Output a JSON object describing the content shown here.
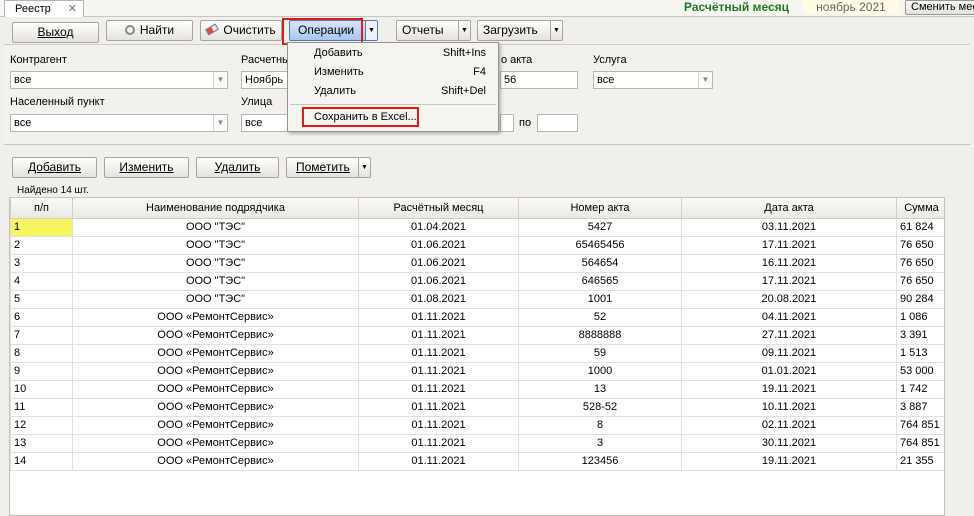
{
  "tab": {
    "label": "Реестр",
    "close": "✕"
  },
  "header": {
    "month_label": "Расчётный месяц",
    "month_value": "ноябрь 2021",
    "change_button": "Сменить мес"
  },
  "toolbar": {
    "exit": "Выход",
    "find": "Найти",
    "clear": "Очистить",
    "operations": "Операции",
    "reports": "Отчеты",
    "load": "Загрузить"
  },
  "filters": {
    "contractor": {
      "label": "Контрагент",
      "value": "все"
    },
    "settlement": {
      "label": "Населенный пункт",
      "value": "все"
    },
    "calc_month": {
      "label": "Расчетны",
      "value": "Ноябрь"
    },
    "street": {
      "label": "Улица",
      "value": "все"
    },
    "act_no": {
      "label": "о акта",
      "value": "56"
    },
    "service": {
      "label": "Услуга",
      "value": "все"
    },
    "range_to_label": "по"
  },
  "menu": {
    "items": [
      {
        "label": "Добавить",
        "shortcut": "Shift+Ins"
      },
      {
        "label": "Изменить",
        "shortcut": "F4"
      },
      {
        "label": "Удалить",
        "shortcut": "Shift+Del"
      },
      {
        "label": "Сохранить в Excel...",
        "shortcut": ""
      }
    ]
  },
  "actions": {
    "add": "Добавить",
    "edit": "Изменить",
    "delete": "Удалить",
    "mark": "Пометить"
  },
  "found_text": "Найдено 14 шт.",
  "table": {
    "columns": [
      "п/п",
      "Наименование подрядчика",
      "Расчётный месяц",
      "Номер акта",
      "Дата акта",
      "Сумма"
    ],
    "rows": [
      [
        "1",
        "ООО \"ТЭС\"",
        "01.04.2021",
        "5427",
        "03.11.2021",
        "61 824"
      ],
      [
        "2",
        "ООО \"ТЭС\"",
        "01.06.2021",
        "65465456",
        "17.11.2021",
        "76 650"
      ],
      [
        "3",
        "ООО \"ТЭС\"",
        "01.06.2021",
        "564654",
        "16.11.2021",
        "76 650"
      ],
      [
        "4",
        "ООО \"ТЭС\"",
        "01.06.2021",
        "646565",
        "17.11.2021",
        "76 650"
      ],
      [
        "5",
        "ООО \"ТЭС\"",
        "01.08.2021",
        "1001",
        "20.08.2021",
        "90 284"
      ],
      [
        "6",
        "ООО  «РемонтСервис»",
        "01.11.2021",
        "52",
        "04.11.2021",
        "1 086"
      ],
      [
        "7",
        "ООО  «РемонтСервис»",
        "01.11.2021",
        "8888888",
        "27.11.2021",
        "3 391"
      ],
      [
        "8",
        "ООО  «РемонтСервис»",
        "01.11.2021",
        "59",
        "09.11.2021",
        "1 513"
      ],
      [
        "9",
        "ООО  «РемонтСервис»",
        "01.11.2021",
        "1000",
        "01.01.2021",
        "53 000"
      ],
      [
        "10",
        "ООО  «РемонтСервис»",
        "01.11.2021",
        "13",
        "19.11.2021",
        "1 742"
      ],
      [
        "11",
        "ООО  «РемонтСервис»",
        "01.11.2021",
        "528-52",
        "10.11.2021",
        "3 887"
      ],
      [
        "12",
        "ООО  «РемонтСервис»",
        "01.11.2021",
        "8",
        "02.11.2021",
        "764 851"
      ],
      [
        "13",
        "ООО  «РемонтСервис»",
        "01.11.2021",
        "3",
        "30.11.2021",
        "764 851"
      ],
      [
        "14",
        "ООО  «РемонтСервис»",
        "01.11.2021",
        "123456",
        "19.11.2021",
        "21 355"
      ]
    ]
  },
  "colors": {
    "highlight_border": "#e01b1b",
    "selected_cell": "#f5f560",
    "month_label": "#1f7a1f"
  }
}
